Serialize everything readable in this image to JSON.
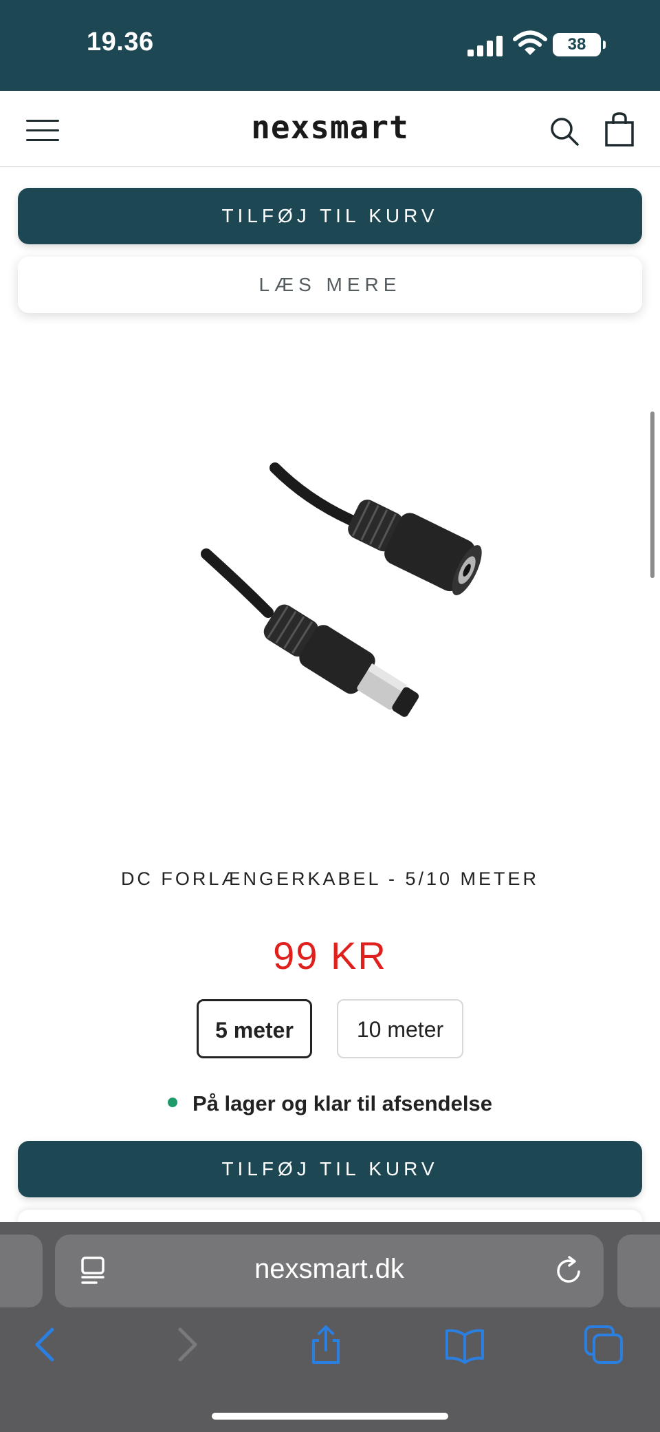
{
  "status_bar": {
    "time": "19.36",
    "battery": "38"
  },
  "header": {
    "logo": "nexsmart"
  },
  "buttons": {
    "add_to_cart": "TILFØJ TIL KURV",
    "read_more": "LÆS MERE"
  },
  "product": {
    "title": "DC FORLÆNGERKABEL - 5/10 METER",
    "price": "99 KR",
    "variants": [
      "5 meter",
      "10 meter"
    ],
    "selected_variant": "5 meter",
    "stock_text": "På lager og klar til afsendelse",
    "stock_color": "#1f9a6a",
    "price_color": "#e0201c"
  },
  "browser": {
    "url": "nexsmart.dk"
  },
  "colors": {
    "brand": "#1c4753",
    "toolbar": "#5b5b5d",
    "toolbar_icon": "#2a7fe0"
  }
}
